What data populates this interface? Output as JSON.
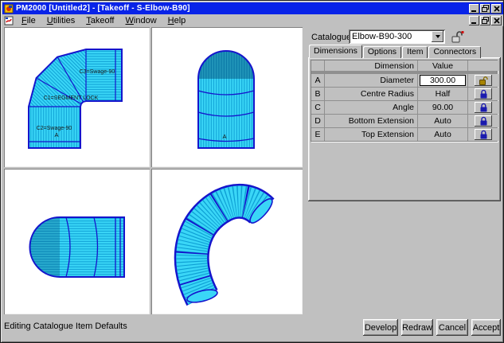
{
  "window": {
    "title": "PM2000 [Untitled2] - [Takeoff - S-Elbow-B90]"
  },
  "menu": {
    "items": [
      {
        "label": "File"
      },
      {
        "label": "Utilities"
      },
      {
        "label": "Takeoff"
      },
      {
        "label": "Window"
      },
      {
        "label": "Help"
      }
    ]
  },
  "catalogue": {
    "label": "Catalogue",
    "value": "Elbow-B90-300"
  },
  "tabs": [
    {
      "label": "Dimensions",
      "active": true
    },
    {
      "label": "Options",
      "active": false
    },
    {
      "label": "Item",
      "active": false
    },
    {
      "label": "Connectors",
      "active": false
    }
  ],
  "table": {
    "headers": {
      "dimension": "Dimension",
      "value": "Value"
    },
    "rows": [
      {
        "id": "A",
        "dimension": "Diameter",
        "value": "300.00",
        "locked": false,
        "editing": true
      },
      {
        "id": "B",
        "dimension": "Centre Radius",
        "value": "Half",
        "locked": true
      },
      {
        "id": "C",
        "dimension": "Angle",
        "value": "90.00",
        "locked": true
      },
      {
        "id": "D",
        "dimension": "Bottom Extension",
        "value": "Auto",
        "locked": true
      },
      {
        "id": "E",
        "dimension": "Top Extension",
        "value": "Auto",
        "locked": true
      }
    ]
  },
  "viewports": {
    "front": {
      "labels": {
        "c3": "C3=Swage-90",
        "c1": "C1=SEGMENT LOCK",
        "c2": "C2=Swage-90",
        "a": "A"
      }
    },
    "side": {
      "marker": "A"
    }
  },
  "buttons": [
    {
      "label": "Develop"
    },
    {
      "label": "Redraw"
    },
    {
      "label": "Cancel"
    },
    {
      "label": "Accept"
    }
  ],
  "status": {
    "text": "Editing Catalogue Item Defaults"
  },
  "colors": {
    "titlebar": "#0823e8",
    "pipe_fill": "#3ad6f7",
    "pipe_stripe": "#0d9fd4",
    "pipe_edge": "#1515cc",
    "lock_locked": "#1a1aae",
    "lock_unlocked": "#8a6d00"
  }
}
